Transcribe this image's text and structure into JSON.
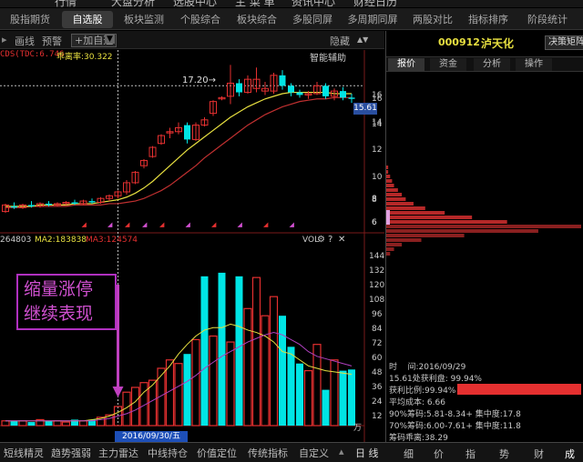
{
  "top_menu": [
    "行情",
    "大盘分析",
    "选股中心",
    "主 菜 单",
    "资讯中心",
    "财经日历"
  ],
  "tabs": [
    "股指期货",
    "自选股",
    "板块监测",
    "个股综合",
    "板块综合",
    "多股同屏",
    "多周期同屏",
    "两股对比",
    "指标排序",
    "阶段统计"
  ],
  "toolbar": {
    "item1": "画线",
    "item2": "预警",
    "add_label": "+加自选",
    "dropdown": "▼",
    "hide_label": "隐藏",
    "collapse_icon": "▲▼"
  },
  "main_chart": {
    "indicator_text": "CDS(TDC:6.746",
    "divergence_label": "乖离率:30.322",
    "assist_label": "智能辅助",
    "high_marker": "17.20→",
    "price_tag": "15.61",
    "axis_ticks": [
      "16",
      "14",
      "12",
      "10",
      "8",
      "6"
    ]
  },
  "vol_chart": {
    "ma_label1": "264803",
    "ma_label2": "MA2:183838",
    "ma_label3": "MA3:124574",
    "vol_label": "VOL",
    "axis_ticks": [
      "144",
      "132",
      "120",
      "108",
      "96",
      "84",
      "72",
      "60",
      "48",
      "36",
      "24",
      "12"
    ],
    "unit": "万",
    "date_tag": "2016/09/30/五"
  },
  "annotation": {
    "line1": "缩量涨停",
    "line2": "继续表现"
  },
  "right_panel": {
    "code": "000912",
    "name": "泸天化",
    "decision_button": "决策矩阵",
    "subtabs": [
      "报价",
      "资金",
      "分析",
      "操作"
    ],
    "price_ticks": [
      "16",
      "14",
      "12",
      "10",
      "8",
      "6"
    ],
    "info": {
      "time_label": "时",
      "time_value": "间:2016/09/29",
      "profit": "15.61处获利盘: 99.94%",
      "profit_ratio": "获利比例:99.94%",
      "avg_cost": "平均成本: 6.66",
      "c90": "90%筹码:5.81-8.34+ 集中度:17.8",
      "c70": "70%筹码:6.00-7.61+ 集中度:11.8",
      "ratio": "筹码乖离:38.29"
    },
    "bottom_tabs": [
      "细",
      "价",
      "指",
      "势",
      "财",
      "成"
    ]
  },
  "bottom_tabs": [
    "短线精灵",
    "趋势强弱",
    "主力雷达",
    "中线持仓",
    "价值定位",
    "传统指标",
    "自定义"
  ],
  "bottom_right": "日 线",
  "colors": {
    "up": "#e53030",
    "down": "#00e5e5",
    "ma1": "#e8e8e8",
    "ma2": "#e8e040",
    "ma3": "#c03030",
    "annotation": "#c040c0",
    "accent": "#e53030"
  },
  "chart_data": [
    {
      "type": "candlestick",
      "note": "daily K-line",
      "y_axis": [
        5,
        17.5
      ],
      "candles": [
        {
          "o": 6.0,
          "h": 6.6,
          "l": 5.9,
          "c": 6.5,
          "up": true
        },
        {
          "o": 6.4,
          "h": 6.7,
          "l": 6.2,
          "c": 6.3,
          "up": false
        },
        {
          "o": 6.3,
          "h": 6.6,
          "l": 6.2,
          "c": 6.5,
          "up": true
        },
        {
          "o": 6.5,
          "h": 6.8,
          "l": 6.3,
          "c": 6.4,
          "up": false
        },
        {
          "o": 6.4,
          "h": 6.7,
          "l": 6.3,
          "c": 6.6,
          "up": true
        },
        {
          "o": 6.6,
          "h": 6.8,
          "l": 6.4,
          "c": 6.5,
          "up": false
        },
        {
          "o": 6.5,
          "h": 6.7,
          "l": 6.4,
          "c": 6.6,
          "up": true
        },
        {
          "o": 6.6,
          "h": 6.8,
          "l": 6.5,
          "c": 6.7,
          "up": true
        },
        {
          "o": 6.7,
          "h": 6.9,
          "l": 6.5,
          "c": 6.6,
          "up": false
        },
        {
          "o": 6.6,
          "h": 6.9,
          "l": 6.5,
          "c": 6.8,
          "up": true
        },
        {
          "o": 6.8,
          "h": 7.0,
          "l": 6.6,
          "c": 6.7,
          "up": false
        },
        {
          "o": 6.7,
          "h": 7.1,
          "l": 6.6,
          "c": 7.0,
          "up": true
        },
        {
          "o": 7.0,
          "h": 7.3,
          "l": 6.8,
          "c": 7.2,
          "up": true
        },
        {
          "o": 7.2,
          "h": 7.6,
          "l": 7.0,
          "c": 7.5,
          "up": true
        },
        {
          "o": 7.5,
          "h": 8.4,
          "l": 7.3,
          "c": 8.2,
          "up": true
        },
        {
          "o": 8.2,
          "h": 9.1,
          "l": 8.1,
          "c": 9.0,
          "up": true
        },
        {
          "o": 9.5,
          "h": 10.0,
          "l": 9.3,
          "c": 9.9,
          "up": true
        },
        {
          "o": 10.2,
          "h": 11.0,
          "l": 10.1,
          "c": 10.9,
          "up": true
        },
        {
          "o": 11.2,
          "h": 11.9,
          "l": 11.1,
          "c": 11.8,
          "up": true
        },
        {
          "o": 12.0,
          "h": 12.4,
          "l": 11.6,
          "c": 12.1,
          "up": true
        },
        {
          "o": 12.1,
          "h": 12.8,
          "l": 11.9,
          "c": 12.4,
          "up": true
        },
        {
          "o": 12.6,
          "h": 12.8,
          "l": 11.2,
          "c": 11.5,
          "up": false
        },
        {
          "o": 11.5,
          "h": 12.8,
          "l": 11.4,
          "c": 12.6,
          "up": true
        },
        {
          "o": 12.6,
          "h": 13.2,
          "l": 12.5,
          "c": 13.0,
          "up": true
        },
        {
          "o": 13.5,
          "h": 14.5,
          "l": 13.3,
          "c": 14.4,
          "up": true
        },
        {
          "o": 14.6,
          "h": 14.8,
          "l": 14.5,
          "c": 14.7,
          "up": true
        },
        {
          "o": 14.8,
          "h": 17.2,
          "l": 14.2,
          "c": 15.8,
          "up": true
        },
        {
          "o": 15.8,
          "h": 16.1,
          "l": 14.8,
          "c": 15.1,
          "up": false
        },
        {
          "o": 15.1,
          "h": 16.4,
          "l": 15.0,
          "c": 16.1,
          "up": true
        },
        {
          "o": 16.1,
          "h": 17.0,
          "l": 15.1,
          "c": 15.4,
          "up": true
        },
        {
          "o": 15.4,
          "h": 15.9,
          "l": 14.9,
          "c": 15.2,
          "up": true
        },
        {
          "o": 15.2,
          "h": 16.6,
          "l": 15.0,
          "c": 16.4,
          "up": true
        },
        {
          "o": 16.4,
          "h": 16.8,
          "l": 15.3,
          "c": 15.6,
          "up": false
        },
        {
          "o": 15.6,
          "h": 15.8,
          "l": 14.8,
          "c": 15.1,
          "up": false
        },
        {
          "o": 15.1,
          "h": 15.3,
          "l": 14.7,
          "c": 14.9,
          "up": false
        },
        {
          "o": 14.9,
          "h": 15.2,
          "l": 14.6,
          "c": 15.0,
          "up": true
        },
        {
          "o": 15.0,
          "h": 15.9,
          "l": 14.9,
          "c": 15.6,
          "up": true
        },
        {
          "o": 15.6,
          "h": 15.8,
          "l": 14.6,
          "c": 14.8,
          "up": false
        },
        {
          "o": 14.8,
          "h": 15.4,
          "l": 14.5,
          "c": 15.2,
          "up": true
        },
        {
          "o": 15.2,
          "h": 15.5,
          "l": 14.5,
          "c": 14.7,
          "up": false
        },
        {
          "o": 14.7,
          "h": 15.0,
          "l": 14.3,
          "c": 14.6,
          "up": false
        }
      ],
      "ma_fast": [
        6.4,
        6.4,
        6.4,
        6.4,
        6.5,
        6.5,
        6.5,
        6.5,
        6.6,
        6.6,
        6.6,
        6.7,
        6.8,
        6.9,
        7.1,
        7.4,
        7.8,
        8.3,
        8.9,
        9.5,
        10.1,
        10.7,
        11.2,
        11.7,
        12.2,
        12.7,
        13.2,
        13.6,
        14.0,
        14.3,
        14.6,
        14.8,
        15.0,
        15.1,
        15.1,
        15.1,
        15.1,
        15.1,
        15.0,
        15.0,
        15.0
      ],
      "ma_slow": [
        6.3,
        6.3,
        6.3,
        6.4,
        6.4,
        6.4,
        6.4,
        6.4,
        6.5,
        6.5,
        6.5,
        6.5,
        6.6,
        6.6,
        6.7,
        6.8,
        7.0,
        7.3,
        7.6,
        8.0,
        8.5,
        9.0,
        9.5,
        10.1,
        10.6,
        11.1,
        11.6,
        12.1,
        12.6,
        13.0,
        13.4,
        13.7,
        14.0,
        14.2,
        14.4,
        14.5,
        14.6,
        14.6,
        14.7,
        14.7,
        14.7
      ]
    },
    {
      "type": "bar",
      "note": "volume (万)",
      "y_axis": [
        0,
        150
      ],
      "values": [
        4,
        4,
        4,
        3,
        5,
        4,
        4,
        3,
        5,
        4,
        5,
        7,
        9,
        16,
        28,
        32,
        36,
        38,
        48,
        55,
        52,
        60,
        72,
        125,
        75,
        128,
        70,
        125,
        98,
        124,
        92,
        108,
        92,
        66,
        52,
        46,
        68,
        30,
        55,
        46,
        47
      ],
      "up": [
        true,
        false,
        true,
        false,
        true,
        false,
        true,
        true,
        false,
        true,
        false,
        true,
        true,
        true,
        true,
        true,
        true,
        true,
        true,
        true,
        true,
        false,
        true,
        false,
        true,
        false,
        true,
        false,
        true,
        true,
        true,
        true,
        false,
        false,
        false,
        true,
        true,
        false,
        true,
        false,
        false
      ],
      "ma_a": [
        4,
        4,
        4,
        4,
        4,
        4,
        4,
        4,
        4,
        4,
        5,
        6,
        8,
        11,
        15,
        20,
        28,
        34,
        42,
        50,
        60,
        68,
        75,
        80,
        82,
        82,
        85,
        83,
        80,
        78,
        75,
        70,
        62,
        60,
        55,
        50,
        48,
        46,
        45,
        44,
        43
      ],
      "ma_b": [
        4,
        4,
        4,
        4,
        4,
        4,
        4,
        4,
        4,
        4,
        4,
        5,
        6,
        8,
        10,
        13,
        17,
        21,
        25,
        29,
        33,
        37,
        42,
        48,
        53,
        58,
        62,
        66,
        70,
        73,
        76,
        78,
        76,
        72,
        68,
        62,
        58,
        56,
        54,
        52,
        50
      ]
    }
  ],
  "chip_distribution": [
    0,
    0,
    0,
    0,
    0,
    0,
    0,
    0,
    0,
    0,
    0,
    0,
    0,
    0,
    0,
    0,
    0,
    0,
    0,
    0,
    1,
    1,
    2,
    3,
    4,
    6,
    8,
    10,
    14,
    20,
    30,
    44,
    62,
    100,
    78,
    40,
    18,
    8,
    4,
    2
  ]
}
